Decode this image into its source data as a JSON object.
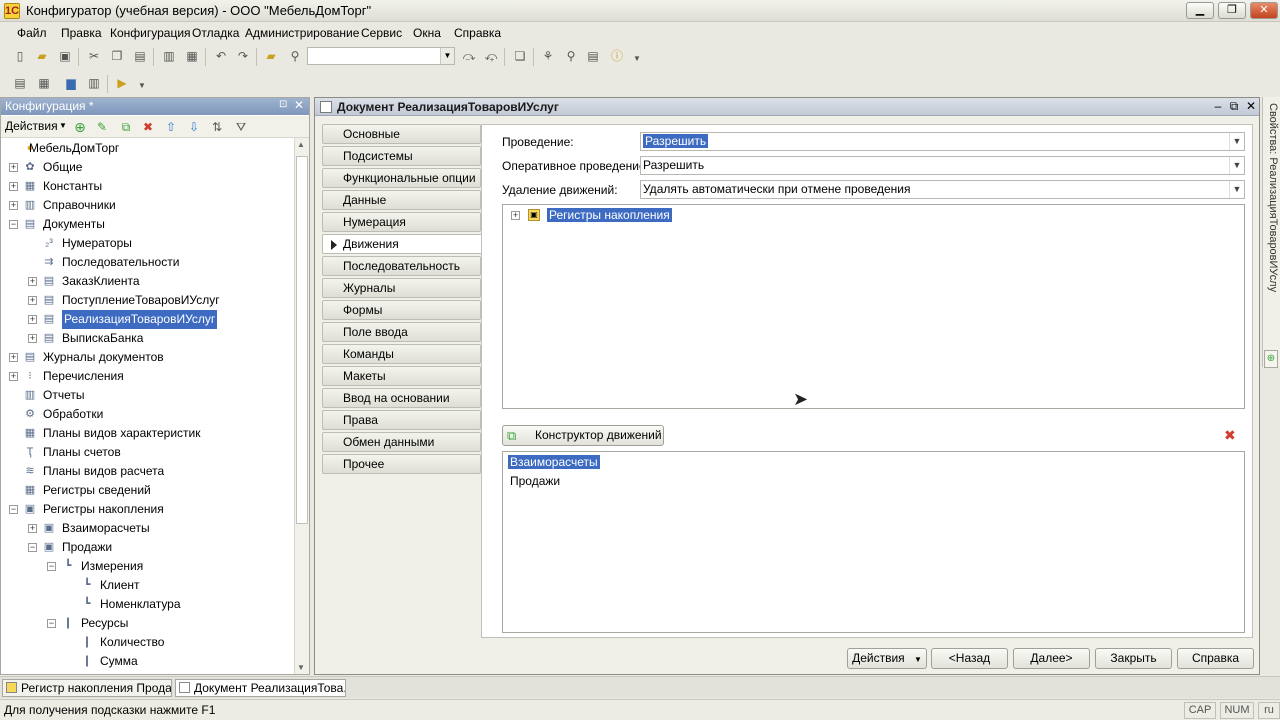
{
  "window": {
    "title": "Конфигуратор (учебная версия) - ООО \"МебельДомТорг\"",
    "app_icon": "1С",
    "controls": {
      "minimize": "▁",
      "restore": "❐",
      "close": "✕"
    }
  },
  "menu": {
    "items": [
      "Файл",
      "Правка",
      "Конфигурация",
      "Отладка",
      "Администрирование",
      "Сервис",
      "Окна",
      "Справка"
    ]
  },
  "left_panel": {
    "title": "Конфигурация *",
    "actions_label": "Действия",
    "pin": "⊡",
    "close": "✕",
    "tree": [
      {
        "label": "МебельДомТорг",
        "level": 0,
        "exp": "",
        "icon": "●"
      },
      {
        "label": "Общие",
        "level": 0,
        "exp": "+",
        "icon": "✿"
      },
      {
        "label": "Константы",
        "level": 0,
        "exp": "+",
        "icon": "▦"
      },
      {
        "label": "Справочники",
        "level": 0,
        "exp": "+",
        "icon": "▥"
      },
      {
        "label": "Документы",
        "level": 0,
        "exp": "−",
        "icon": "▤"
      },
      {
        "label": "Нумераторы",
        "level": 1,
        "exp": "",
        "icon": "₂³"
      },
      {
        "label": "Последовательности",
        "level": 1,
        "exp": "",
        "icon": "⇉"
      },
      {
        "label": "ЗаказКлиента",
        "level": 1,
        "exp": "+",
        "icon": "▤"
      },
      {
        "label": "ПоступлениеТоваровИУслуг",
        "level": 1,
        "exp": "+",
        "icon": "▤"
      },
      {
        "label": "РеализацияТоваровИУслуг",
        "level": 1,
        "exp": "+",
        "icon": "▤",
        "selected": true
      },
      {
        "label": "ВыпискаБанка",
        "level": 1,
        "exp": "+",
        "icon": "▤"
      },
      {
        "label": "Журналы документов",
        "level": 0,
        "exp": "+",
        "icon": "▤"
      },
      {
        "label": "Перечисления",
        "level": 0,
        "exp": "+",
        "icon": "⁝"
      },
      {
        "label": "Отчеты",
        "level": 0,
        "exp": "",
        "icon": "▥"
      },
      {
        "label": "Обработки",
        "level": 0,
        "exp": "",
        "icon": "⚙"
      },
      {
        "label": "Планы видов характеристик",
        "level": 0,
        "exp": "",
        "icon": "▦"
      },
      {
        "label": "Планы счетов",
        "level": 0,
        "exp": "",
        "icon": "Ҭ"
      },
      {
        "label": "Планы видов расчета",
        "level": 0,
        "exp": "",
        "icon": "≋"
      },
      {
        "label": "Регистры сведений",
        "level": 0,
        "exp": "",
        "icon": "▦"
      },
      {
        "label": "Регистры накопления",
        "level": 0,
        "exp": "−",
        "icon": "▣"
      },
      {
        "label": "Взаиморасчеты",
        "level": 1,
        "exp": "+",
        "icon": "▣"
      },
      {
        "label": "Продажи",
        "level": 1,
        "exp": "−",
        "icon": "▣"
      },
      {
        "label": "Измерения",
        "level": 2,
        "exp": "−",
        "icon": "┗"
      },
      {
        "label": "Клиент",
        "level": 3,
        "exp": "",
        "icon": "┗"
      },
      {
        "label": "Номенклатура",
        "level": 3,
        "exp": "",
        "icon": "┗"
      },
      {
        "label": "Ресурсы",
        "level": 2,
        "exp": "−",
        "icon": "❙"
      },
      {
        "label": "Количество",
        "level": 3,
        "exp": "",
        "icon": "❙"
      },
      {
        "label": "Сумма",
        "level": 3,
        "exp": "",
        "icon": "❙"
      }
    ]
  },
  "document": {
    "title": "Документ РеализацияТоваровИУслуг",
    "controls": {
      "minimize": "–",
      "restore": "⧉",
      "close": "✕"
    },
    "tabs": [
      "Основные",
      "Подсистемы",
      "Функциональные опции",
      "Данные",
      "Нумерация",
      "Движения",
      "Последовательность",
      "Журналы",
      "Формы",
      "Поле ввода",
      "Команды",
      "Макеты",
      "Ввод на основании",
      "Права",
      "Обмен данными",
      "Прочее"
    ],
    "active_tab": 5,
    "fields": {
      "posting_label": "Проведение:",
      "posting_value": "Разрешить",
      "realtime_label": "Оперативное проведение:",
      "realtime_value": "Разрешить",
      "delete_label": "Удаление движений:",
      "delete_value": "Удалять автоматически при отмене проведения"
    },
    "registers_tree_node": "Регистры накопления",
    "constructor_button": "Конструктор движений",
    "remove_icon": "✖",
    "registers_list": [
      "Взаиморасчеты",
      "Продажи"
    ],
    "footer_buttons": {
      "actions": "Действия",
      "back": "<Назад",
      "next": "Далее>",
      "close": "Закрыть",
      "help": "Справка"
    }
  },
  "right_dock": {
    "label": "Свойства: РеализацияТоваровИУслу"
  },
  "taskbar": {
    "items": [
      "Регистр накопления Прода...",
      "Документ РеализацияТова..."
    ]
  },
  "status": {
    "hint": "Для получения подсказки нажмите F1",
    "cap": "CAP",
    "num": "NUM",
    "lang": "ru"
  },
  "colors": {
    "selection": "#3d6bc2",
    "accent_green": "#3aa33a",
    "remove_red": "#d23c2c"
  }
}
